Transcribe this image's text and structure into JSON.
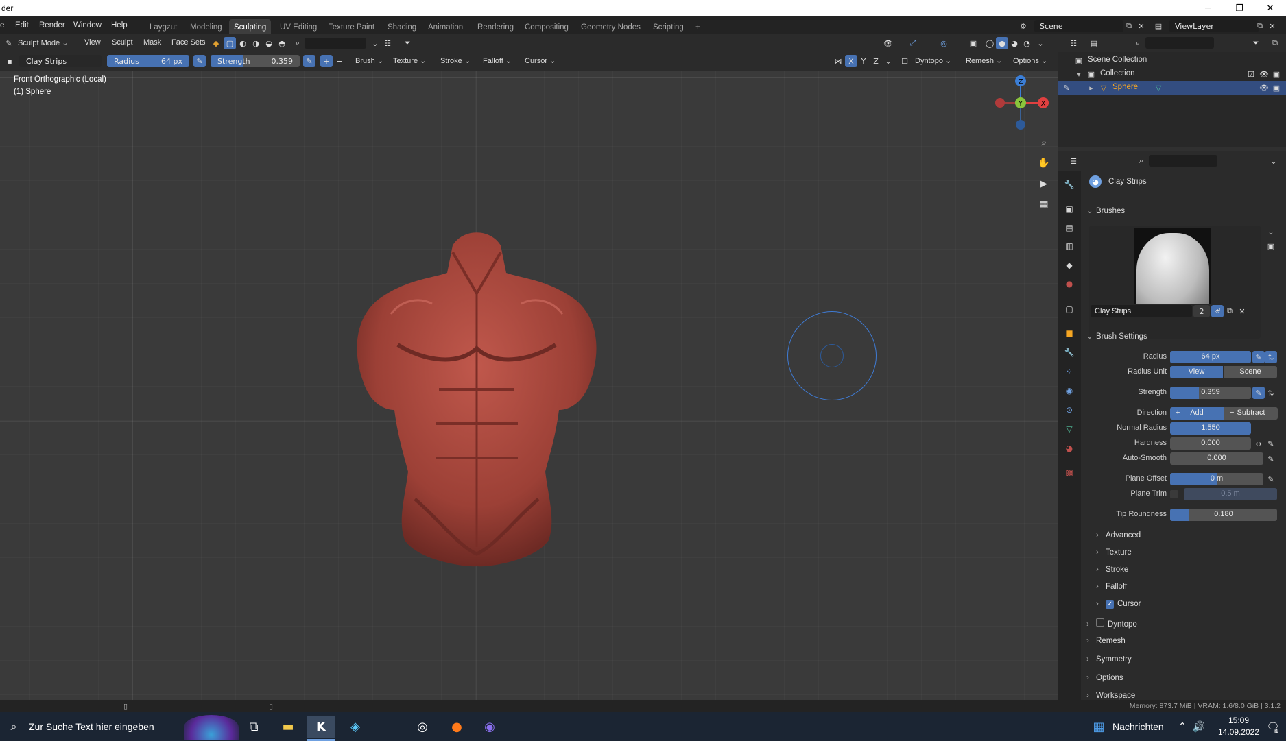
{
  "window": {
    "title": "der",
    "minimize": "─",
    "maximize": "❐",
    "close": "✕"
  },
  "topbar": {
    "menus": [
      "e",
      "Edit",
      "Render",
      "Window",
      "Help"
    ],
    "workspaces": [
      "Laygzut",
      "Modeling",
      "Sculpting",
      "UV Editing",
      "Texture Paint",
      "Shading",
      "Animation",
      "Rendering",
      "Compositing",
      "Geometry Nodes",
      "Scripting"
    ],
    "active_workspace": "Sculpting",
    "add_tab": "+",
    "scene": "Scene",
    "view_layer": "ViewLayer"
  },
  "header1": {
    "mode": "Sculpt Mode",
    "view": "View",
    "sculpt": "Sculpt",
    "mask": "Mask",
    "face_sets": "Face Sets"
  },
  "header2": {
    "brush_name": "Clay Strips",
    "radius_label": "Radius",
    "radius_value": "64 px",
    "strength_label": "Strength",
    "strength_value": "0.359",
    "brush": "Brush",
    "texture": "Texture",
    "stroke": "Stroke",
    "falloff": "Falloff",
    "cursor": "Cursor",
    "x": "X",
    "y": "Y",
    "z": "Z",
    "dyntopo": "Dyntopo",
    "remesh": "Remesh",
    "options": "Options"
  },
  "viewport": {
    "view_name": "Front Orthographic (Local)",
    "object_name": "(1) Sphere",
    "gizmo": {
      "z": "Z",
      "y": "Y",
      "x": "X"
    }
  },
  "outliner": {
    "scene_collection": "Scene Collection",
    "collection": "Collection",
    "object": "Sphere"
  },
  "properties": {
    "tool_name": "Clay Strips",
    "brushes_section": "Brushes",
    "brush_preview_name": "Clay Strips",
    "brush_users": "2",
    "brush_settings_section": "Brush Settings",
    "radius_label": "Radius",
    "radius_value": "64 px",
    "radius_unit_label": "Radius Unit",
    "radius_unit_view": "View",
    "radius_unit_scene": "Scene",
    "strength_label": "Strength",
    "strength_value": "0.359",
    "direction_label": "Direction",
    "direction_add": "Add",
    "direction_subtract": "Subtract",
    "normal_radius_label": "Normal Radius",
    "normal_radius_value": "1.550",
    "hardness_label": "Hardness",
    "hardness_value": "0.000",
    "auto_smooth_label": "Auto-Smooth",
    "auto_smooth_value": "0.000",
    "plane_offset_label": "Plane Offset",
    "plane_offset_value": "0 m",
    "plane_trim_label": "Plane Trim",
    "plane_trim_value": "0.5 m",
    "tip_roundness_label": "Tip Roundness",
    "tip_roundness_value": "0.180",
    "strength_fill": 0.359,
    "tip_roundness_fill": 0.18,
    "subsections": [
      "Advanced",
      "Texture",
      "Stroke",
      "Falloff",
      "Cursor"
    ],
    "sections": [
      "Dyntopo",
      "Remesh",
      "Symmetry",
      "Options",
      "Workspace"
    ]
  },
  "statusbar": {
    "memory": "Memory: 873.7 MiB | VRAM: 1.6/8.0 GiB | 3.1.2"
  },
  "taskbar": {
    "search_placeholder": "Zur Suche Text hier eingeben",
    "news": "Nachrichten",
    "time": "15:09",
    "date": "14.09.2022",
    "notification_count": "4"
  },
  "colors": {
    "accent_blue": "#4772b3",
    "active_object": "#f5a623",
    "axis_red": "#e04040",
    "axis_green": "#8ac43c",
    "axis_blue": "#3b7ed6",
    "sculpt_color": "#a4483f"
  }
}
